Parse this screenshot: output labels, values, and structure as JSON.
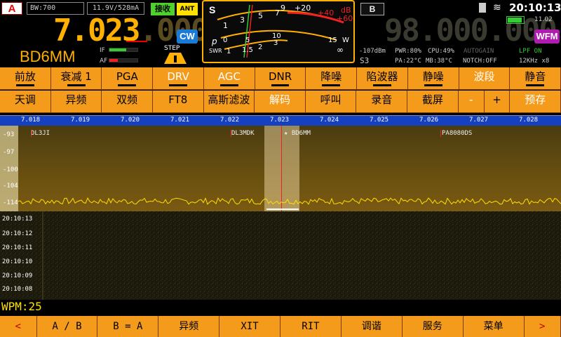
{
  "top": {
    "vfo_a": "A",
    "bw": "BW:700",
    "volt": "11.9V/528mA",
    "rx": "接收",
    "ant": "ANT 1",
    "freq_a_main": "7.023",
    "freq_a_dim": ".000",
    "mode_a": "CW",
    "callsign": "BD6MM",
    "if_label": "IF",
    "af_label": "AF",
    "step_label": "STEP",
    "vfo_b": "B",
    "freq_b": "98.000.000",
    "mode_b": "WFM",
    "time": "20:10:13",
    "battery": "11.02"
  },
  "meter": {
    "s_label": "S",
    "scale_s": [
      "1",
      "3",
      "5",
      "7",
      "9",
      "+20",
      "+40",
      "+60"
    ],
    "db": "dB",
    "p_label": "p",
    "po_scale": [
      "0",
      "1",
      "5",
      "10",
      "15"
    ],
    "w": "W",
    "swr": "SWR",
    "swr_scale": [
      "1",
      "1.5",
      "2",
      "3",
      "∞"
    ]
  },
  "status": {
    "dbm": "-107dBm",
    "pwr": "PWR:80%",
    "cpu": "CPU:49%",
    "autogain": "AUTOGAIN",
    "lpf": "LPF ON",
    "smeter": "S3",
    "pa": "PA:22°C",
    "mb": "MB:38°C",
    "notch": "NOTCH:OFF",
    "span": "12KHz x8"
  },
  "row1": [
    "前放",
    "衰减 1",
    "PGA",
    "DRV",
    "AGC",
    "DNR",
    "降噪",
    "陷波器",
    "静噪",
    "波段",
    "静音"
  ],
  "row2": [
    "天调",
    "异频",
    "双频",
    "FT8",
    "高斯滤波",
    "解码",
    "呼叫",
    "录音",
    "截屏",
    "-",
    "+",
    "预存"
  ],
  "scale": [
    "7.018",
    "7.019",
    "7.020",
    "7.021",
    "7.022",
    "7.023",
    "7.024",
    "7.025",
    "7.026",
    "7.027",
    "7.028"
  ],
  "dbscale": [
    "-93",
    "-97",
    "-100",
    "-104",
    "-114"
  ],
  "spots": [
    "DL3JI",
    "DL3MDK",
    "★ BD6MM",
    "PA8080DS"
  ],
  "times": [
    "20:10:13",
    "20:10:12",
    "20:10:11",
    "20:10:10",
    "20:10:09",
    "20:10:08"
  ],
  "wpm": "WPM:25",
  "bottom": [
    "<",
    "A / B",
    "B = A",
    "异频",
    "XIT",
    "RIT",
    "调谐",
    "服务",
    "菜单",
    ">"
  ],
  "colors": {
    "accent": "#f59b1c",
    "freq": "#ffb000",
    "rx": "#4ed12a",
    "ant": "#ffe000",
    "cw": "#1a7ad6",
    "wfm": "#b01cb0"
  }
}
